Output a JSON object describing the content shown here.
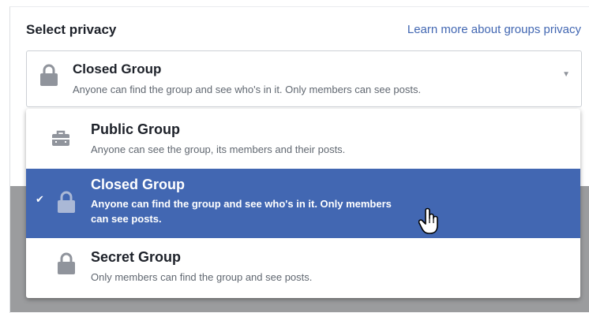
{
  "privacy": {
    "section_title": "Select privacy",
    "learn_more_link": "Learn more about groups privacy",
    "selected": {
      "title": "Closed Group",
      "description": "Anyone can find the group and see who's in it. Only members can see posts.",
      "icon": "lock-icon"
    },
    "options": [
      {
        "title": "Public Group",
        "description": "Anyone can see the group, its members and their posts.",
        "icon": "briefcase-icon",
        "selected": false
      },
      {
        "title": "Closed Group",
        "description": "Anyone can find the group and see who's in it. Only members can see posts.",
        "icon": "lock-icon",
        "selected": true
      },
      {
        "title": "Secret Group",
        "description": "Only members can find the group and see posts.",
        "icon": "lock-icon",
        "selected": false
      }
    ]
  },
  "colors": {
    "accent": "#4267b2",
    "link": "#4267b2",
    "text_primary": "#1d2129",
    "text_secondary": "#606770",
    "icon_gray": "#90949c"
  }
}
